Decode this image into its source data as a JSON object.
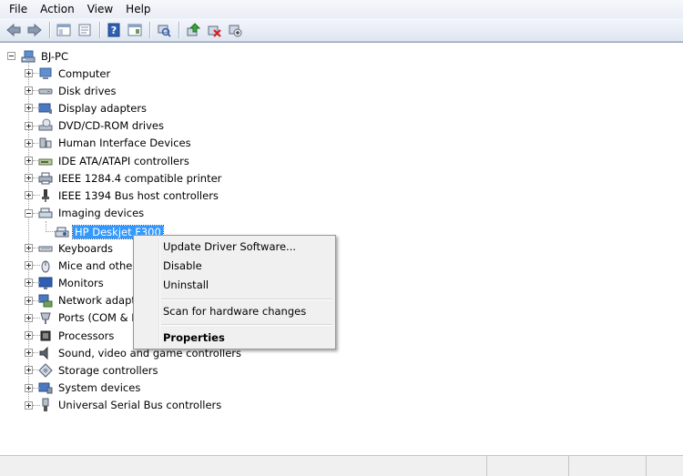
{
  "menu": [
    "File",
    "Action",
    "View",
    "Help"
  ],
  "toolbar": {
    "buttons": [
      "back-icon",
      "forward-icon",
      "show-hide-tree-icon",
      "properties-sheet-icon",
      "help-icon",
      "console-tree-icon",
      "scan-hardware-icon",
      "update-driver-icon",
      "uninstall-icon",
      "disable-icon"
    ]
  },
  "tree": {
    "root": "BJ-PC",
    "categories": [
      {
        "label": "Computer",
        "icon": "computer-icon"
      },
      {
        "label": "Disk drives",
        "icon": "disk-drive-icon"
      },
      {
        "label": "Display adapters",
        "icon": "display-adapter-icon"
      },
      {
        "label": "DVD/CD-ROM drives",
        "icon": "dvd-drive-icon"
      },
      {
        "label": "Human Interface Devices",
        "icon": "hid-icon"
      },
      {
        "label": "IDE ATA/ATAPI controllers",
        "icon": "ide-controller-icon"
      },
      {
        "label": "IEEE 1284.4 compatible printer",
        "icon": "printer-icon"
      },
      {
        "label": "IEEE 1394 Bus host controllers",
        "icon": "firewire-icon"
      },
      {
        "label": "Imaging devices",
        "icon": "imaging-device-icon"
      },
      {
        "label": "Keyboards",
        "icon": "keyboard-icon"
      },
      {
        "label": "Mice and other",
        "icon": "mouse-icon"
      },
      {
        "label": "Monitors",
        "icon": "monitor-icon"
      },
      {
        "label": "Network adapte",
        "icon": "network-adapter-icon"
      },
      {
        "label": "Ports (COM & L",
        "icon": "port-icon"
      },
      {
        "label": "Processors",
        "icon": "processor-icon"
      },
      {
        "label": "Sound, video and game controllers",
        "icon": "sound-icon"
      },
      {
        "label": "Storage controllers",
        "icon": "storage-controller-icon"
      },
      {
        "label": "System devices",
        "icon": "system-device-icon"
      },
      {
        "label": "Universal Serial Bus controllers",
        "icon": "usb-icon"
      }
    ],
    "selected_child": "HP Deskjet F300"
  },
  "context_menu": {
    "items": [
      "Update Driver Software...",
      "Disable",
      "Uninstall",
      "Scan for hardware changes",
      "Properties"
    ]
  }
}
